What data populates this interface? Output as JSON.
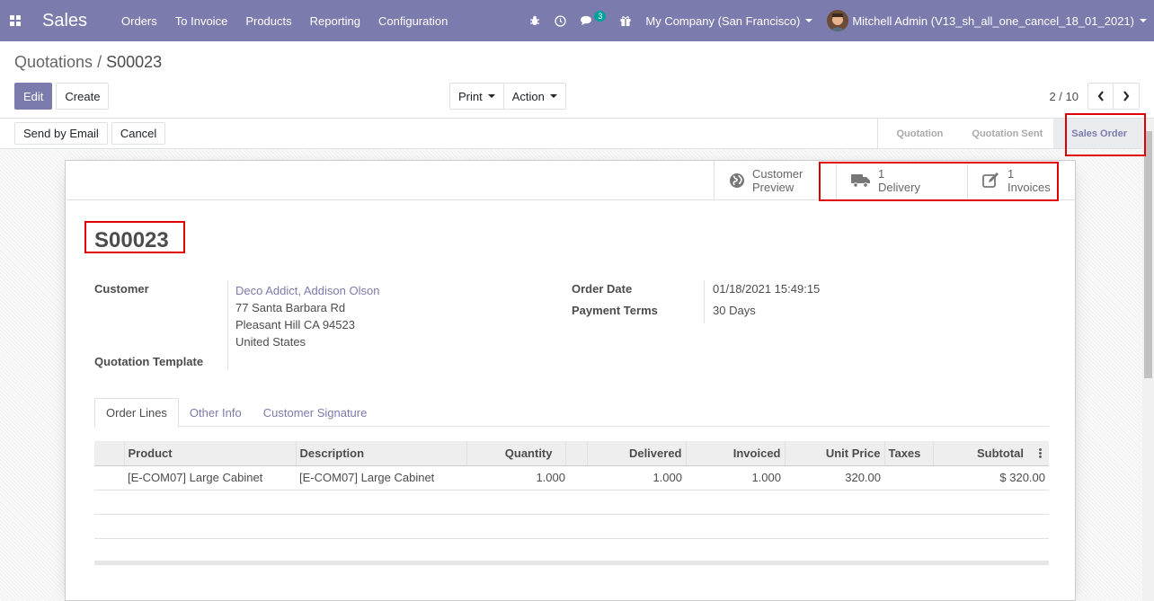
{
  "nav": {
    "app_name": "Sales",
    "menu": [
      "Orders",
      "To Invoice",
      "Products",
      "Reporting",
      "Configuration"
    ],
    "chat_count": "3",
    "company": "My Company (San Francisco)",
    "user": "Mitchell Admin (V13_sh_all_one_cancel_18_01_2021)"
  },
  "breadcrumb": {
    "parent": "Quotations",
    "separator": " / ",
    "current": "S00023"
  },
  "buttons": {
    "edit": "Edit",
    "create": "Create",
    "print": "Print",
    "action": "Action"
  },
  "pager": {
    "value": "2 / 10"
  },
  "status_buttons": {
    "send_email": "Send by Email",
    "cancel": "Cancel"
  },
  "stages": [
    "Quotation",
    "Quotation Sent",
    "Sales Order"
  ],
  "smart_buttons": {
    "preview_line1": "Customer",
    "preview_line2": "Preview",
    "delivery_count": "1",
    "delivery_label": "Delivery",
    "invoice_count": "1",
    "invoice_label": "Invoices"
  },
  "order": {
    "name": "S00023",
    "customer_label": "Customer",
    "customer_name": "Deco Addict, Addison Olson",
    "address1": "77 Santa Barbara Rd",
    "address2": "Pleasant Hill CA 94523",
    "address3": "United States",
    "template_label": "Quotation Template",
    "order_date_label": "Order Date",
    "order_date": "01/18/2021 15:49:15",
    "payment_terms_label": "Payment Terms",
    "payment_terms": "30 Days"
  },
  "tabs": [
    "Order Lines",
    "Other Info",
    "Customer Signature"
  ],
  "lines": {
    "headers": [
      "Product",
      "Description",
      "Quantity",
      "Delivered",
      "Invoiced",
      "Unit Price",
      "Taxes",
      "Subtotal"
    ],
    "rows": [
      {
        "product": "[E-COM07] Large Cabinet",
        "description": "[E-COM07] Large Cabinet",
        "quantity": "1.000",
        "delivered": "1.000",
        "invoiced": "1.000",
        "unit_price": "320.00",
        "taxes": "",
        "subtotal": "$ 320.00"
      }
    ]
  },
  "colors": {
    "brand": "#7c7bad",
    "highlight": "#e00000"
  }
}
